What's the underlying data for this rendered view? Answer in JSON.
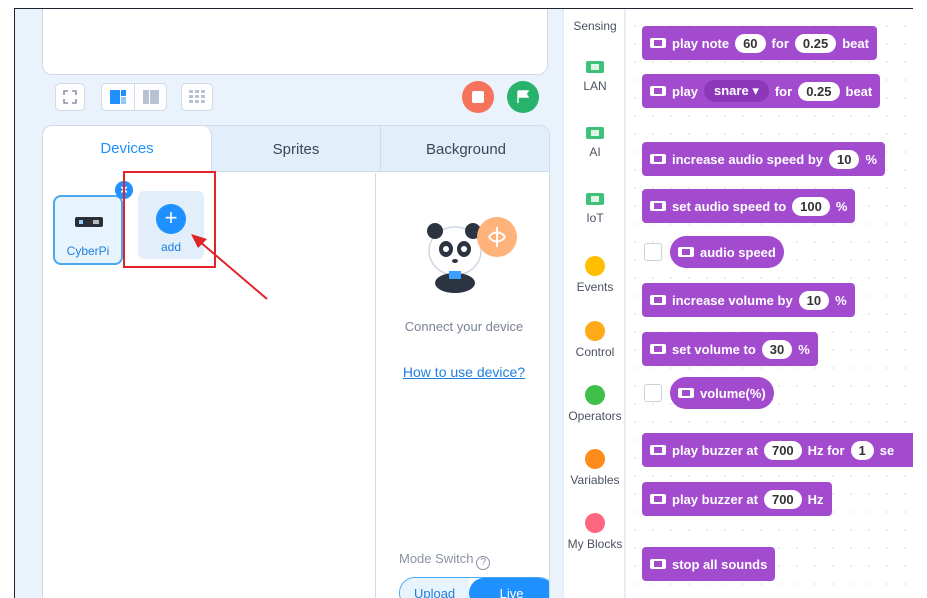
{
  "toolbar": {
    "view_buttons": [
      "fullscreen-view",
      "split-view",
      "grid-view"
    ],
    "stop_color": "#f5725b",
    "go_color": "#27b36b"
  },
  "tabs": [
    {
      "label": "Devices",
      "active": true
    },
    {
      "label": "Sprites",
      "active": false
    },
    {
      "label": "Background",
      "active": false
    }
  ],
  "devices": {
    "connected": {
      "name": "CyberPi",
      "close_symbol": "×"
    },
    "add_label": "add",
    "add_symbol": "+",
    "connect_text": "Connect your device",
    "help_link": "How to use device?",
    "mode_switch_label": "Mode Switch",
    "mode_help_symbol": "?",
    "modes": [
      {
        "label": "Upload",
        "on": false
      },
      {
        "label": "Live",
        "on": true
      }
    ]
  },
  "categories": [
    {
      "label": "Sensing",
      "kind": "text"
    },
    {
      "label": "LAN",
      "kind": "chip",
      "color": "#3ec27a"
    },
    {
      "label": "AI",
      "kind": "chip",
      "color": "#3ec27a"
    },
    {
      "label": "IoT",
      "kind": "chip",
      "color": "#3ec27a"
    },
    {
      "label": "Events",
      "kind": "dot",
      "color": "#ffbf00"
    },
    {
      "label": "Control",
      "kind": "dot",
      "color": "#ffab19"
    },
    {
      "label": "Operators",
      "kind": "dot",
      "color": "#40bf4a"
    },
    {
      "label": "Variables",
      "kind": "dot",
      "color": "#ff8c1a"
    },
    {
      "label": "My Blocks",
      "kind": "dot",
      "color": "#ff6680"
    }
  ],
  "blocks": {
    "play_note": {
      "text": "play note",
      "note": "60",
      "for": "for",
      "beats": "0.25",
      "unit": "beat"
    },
    "play_drum": {
      "text": "play",
      "drum": "snare ▾",
      "for": "for",
      "beats": "0.25",
      "unit": "beat"
    },
    "increase_speed": {
      "text": "increase audio speed by",
      "value": "10",
      "unit": "%"
    },
    "set_speed": {
      "text": "set audio speed to",
      "value": "100",
      "unit": "%"
    },
    "audio_speed": {
      "text": "audio speed"
    },
    "increase_volume": {
      "text": "increase volume by",
      "value": "10",
      "unit": "%"
    },
    "set_volume": {
      "text": "set volume to",
      "value": "30",
      "unit": "%"
    },
    "volume": {
      "text": "volume(%)"
    },
    "buzzer_for": {
      "text": "play buzzer at",
      "hz": "700",
      "hz_unit": "Hz for",
      "secs": "1",
      "secs_unit": "se"
    },
    "buzzer": {
      "text": "play buzzer at",
      "hz": "700",
      "hz_unit": "Hz"
    },
    "stop_sounds": {
      "text": "stop all sounds"
    }
  },
  "block_color": "#a24bcf",
  "accent": "#1e90ff",
  "highlight_color": "#e0242a"
}
